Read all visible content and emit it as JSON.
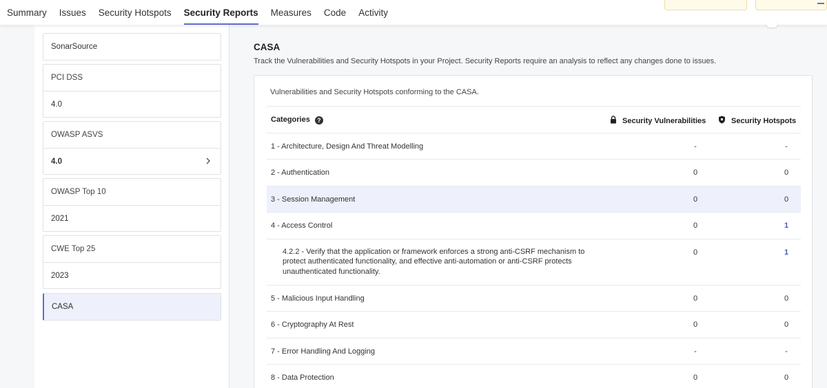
{
  "nav": {
    "tabs": [
      "Summary",
      "Issues",
      "Security Hotspots",
      "Security Reports",
      "Measures",
      "Code",
      "Activity"
    ],
    "active_index": 3
  },
  "sidebar": {
    "groups": [
      {
        "head": "SonarSource",
        "items": []
      },
      {
        "head": "PCI DSS",
        "items": [
          "4.0"
        ]
      },
      {
        "head": "OWASP ASVS",
        "items": [
          "4.0"
        ]
      },
      {
        "head": "OWASP Top 10",
        "items": [
          "2021"
        ]
      },
      {
        "head": "CWE Top 25",
        "items": [
          "2023"
        ]
      },
      {
        "head": "CASA",
        "items": []
      }
    ],
    "selected": "CASA"
  },
  "report": {
    "title": "CASA",
    "description": "Track the Vulnerabilities and Security Hotspots in your Project. Security Reports require an analysis to reflect any changes done to issues.",
    "subtitle": "Vulnerabilities and Security Hotspots conforming to the CASA.",
    "columns": {
      "categories": "Categories",
      "vulnerabilities": "Security Vulnerabilities",
      "hotspots": "Security Hotspots"
    },
    "rows": [
      {
        "category": "1 - Architecture, Design And Threat Modelling",
        "vulnerabilities": "-",
        "hotspots": "-"
      },
      {
        "category": "2 - Authentication",
        "vulnerabilities": "0",
        "hotspots": "0"
      },
      {
        "category": "3 - Session Management",
        "vulnerabilities": "0",
        "hotspots": "0"
      },
      {
        "category": "4 - Access Control",
        "vulnerabilities": "0",
        "hotspots": "1"
      },
      {
        "category": "4.2.2 - Verify that the application or framework enforces a strong anti-CSRF mechanism to protect authenticated functionality, and effective anti-automation or anti-CSRF protects unauthenticated functionality.",
        "vulnerabilities": "0",
        "hotspots": "1"
      },
      {
        "category": "5 - Malicious Input Handling",
        "vulnerabilities": "0",
        "hotspots": "0"
      },
      {
        "category": "6 - Cryptography At Rest",
        "vulnerabilities": "0",
        "hotspots": "0"
      },
      {
        "category": "7 - Error Handling And Logging",
        "vulnerabilities": "-",
        "hotspots": "-"
      },
      {
        "category": "8 - Data Protection",
        "vulnerabilities": "0",
        "hotspots": "0"
      }
    ]
  },
  "colors": {
    "accent": "#5d6cd0",
    "link": "#4a59c2",
    "selected_bg": "#eef0fb"
  }
}
